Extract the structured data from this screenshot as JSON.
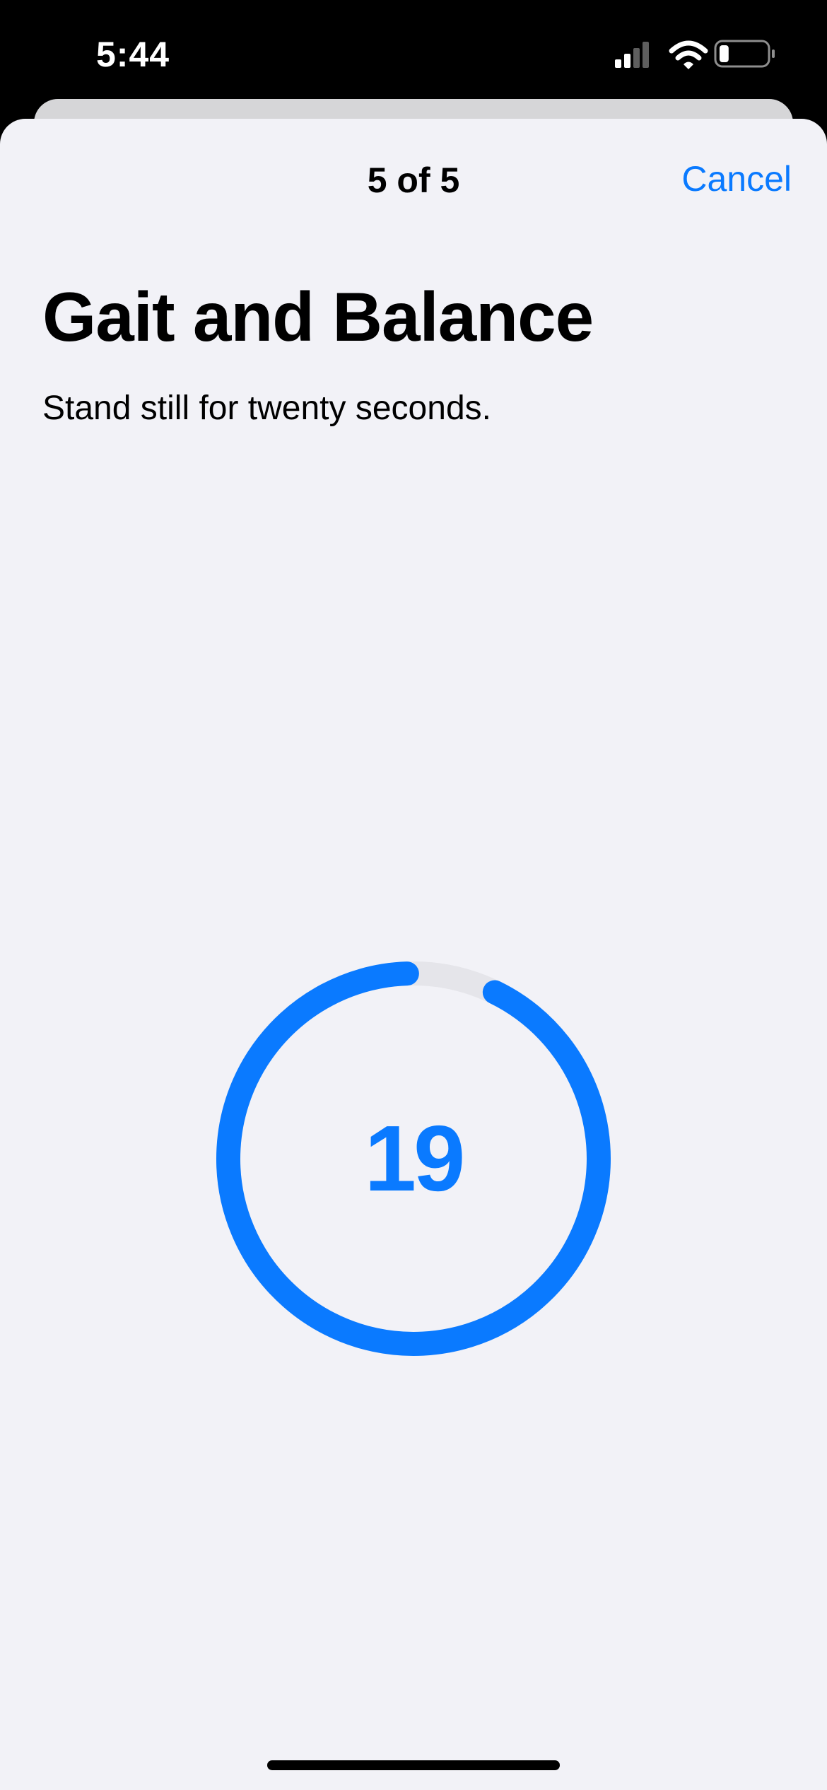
{
  "status_bar": {
    "time": "5:44",
    "icons": [
      "cellular-signal-icon",
      "wifi-icon",
      "battery-icon"
    ],
    "battery_level": 0.2
  },
  "nav": {
    "step": "5 of 5",
    "cancel_label": "Cancel"
  },
  "content": {
    "title": "Gait and Balance",
    "subtitle": "Stand still for twenty seconds."
  },
  "timer": {
    "value": "19",
    "total_seconds": 20,
    "remaining_seconds": 19
  },
  "colors": {
    "accent": "#0a7aff",
    "background": "#f2f2f7",
    "track": "#e5e5ea"
  }
}
